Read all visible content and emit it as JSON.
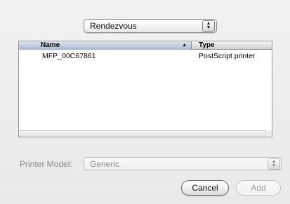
{
  "top_popup": {
    "selected": "Rendezvous",
    "arrows": "▲\n▼"
  },
  "table": {
    "columns": {
      "name": "Name",
      "type": "Type"
    },
    "rows": [
      {
        "name": "MFP_00C67861",
        "type": "PostScript printer"
      }
    ]
  },
  "printer_model": {
    "label": "Printer Model:",
    "selected": "Generic"
  },
  "buttons": {
    "cancel": "Cancel",
    "add": "Add"
  }
}
